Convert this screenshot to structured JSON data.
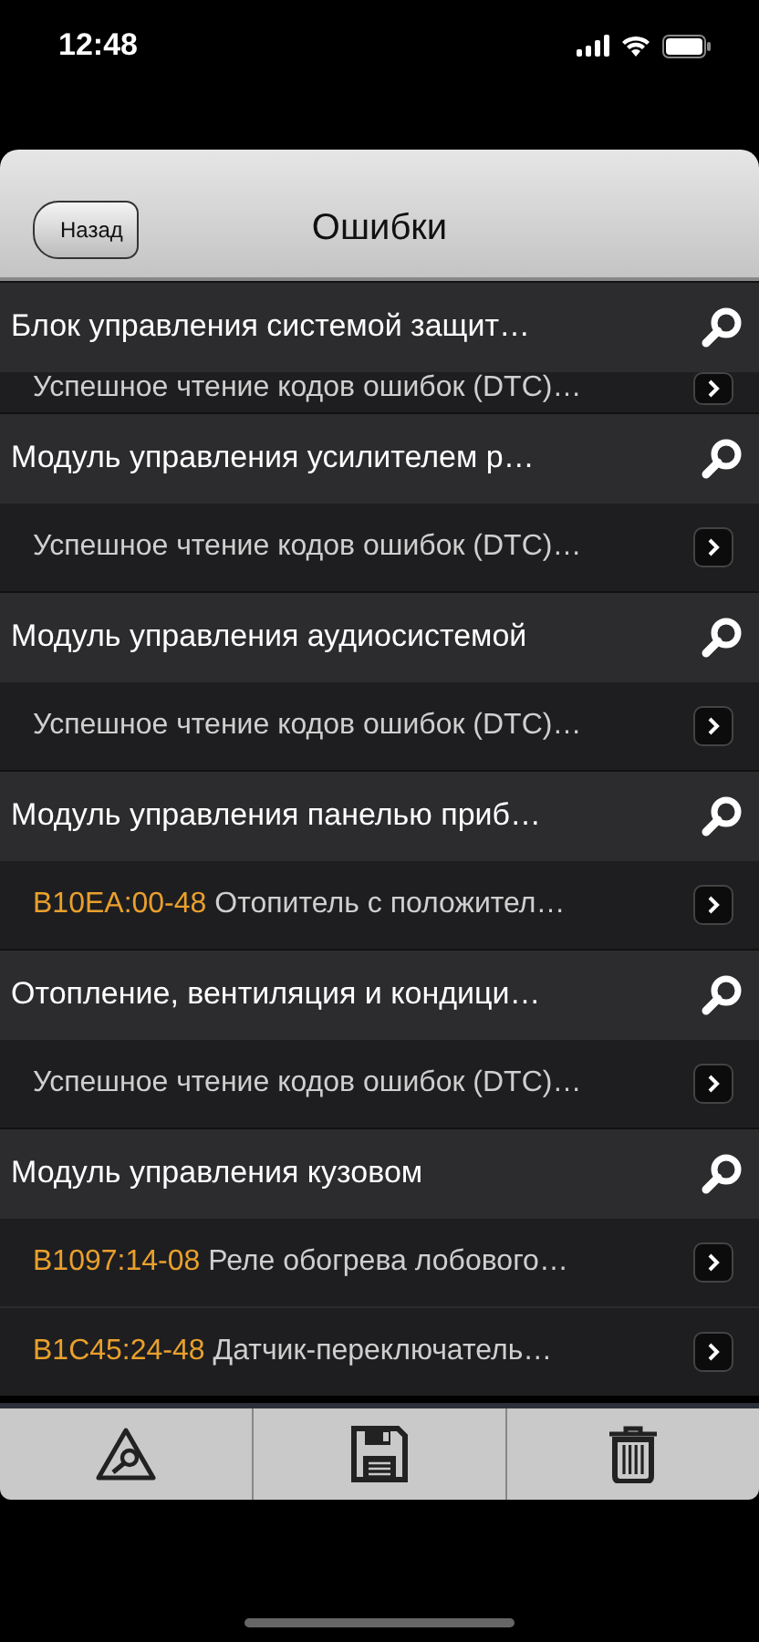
{
  "status_bar": {
    "time": "12:48"
  },
  "nav_bar": {
    "back": "Назад",
    "title": "Ошибки"
  },
  "sections": [
    {
      "title": "Блок управления системой защит…",
      "entries": [
        {
          "text": "Успешное чтение кодов ошибок (DTC)…"
        }
      ]
    },
    {
      "title": "Модуль управления усилителем р…",
      "entries": [
        {
          "text": "Успешное чтение кодов ошибок (DTC)…"
        }
      ]
    },
    {
      "title": "Модуль управления аудиосистемой",
      "entries": [
        {
          "text": "Успешное чтение кодов ошибок (DTC)…"
        }
      ]
    },
    {
      "title": "Модуль управления панелью приб…",
      "entries": [
        {
          "code": "B10EA:00-48",
          "text": "Отопитель с положител…"
        }
      ]
    },
    {
      "title": "Отопление, вентиляция и кондици…",
      "entries": [
        {
          "text": "Успешное чтение кодов ошибок (DTC)…"
        }
      ]
    },
    {
      "title": "Модуль управления кузовом",
      "entries": [
        {
          "code": "B1097:14-08",
          "text": "Реле обогрева лобового…"
        },
        {
          "code": "B1C45:24-48",
          "text": "Датчик-переключатель…"
        }
      ]
    }
  ]
}
